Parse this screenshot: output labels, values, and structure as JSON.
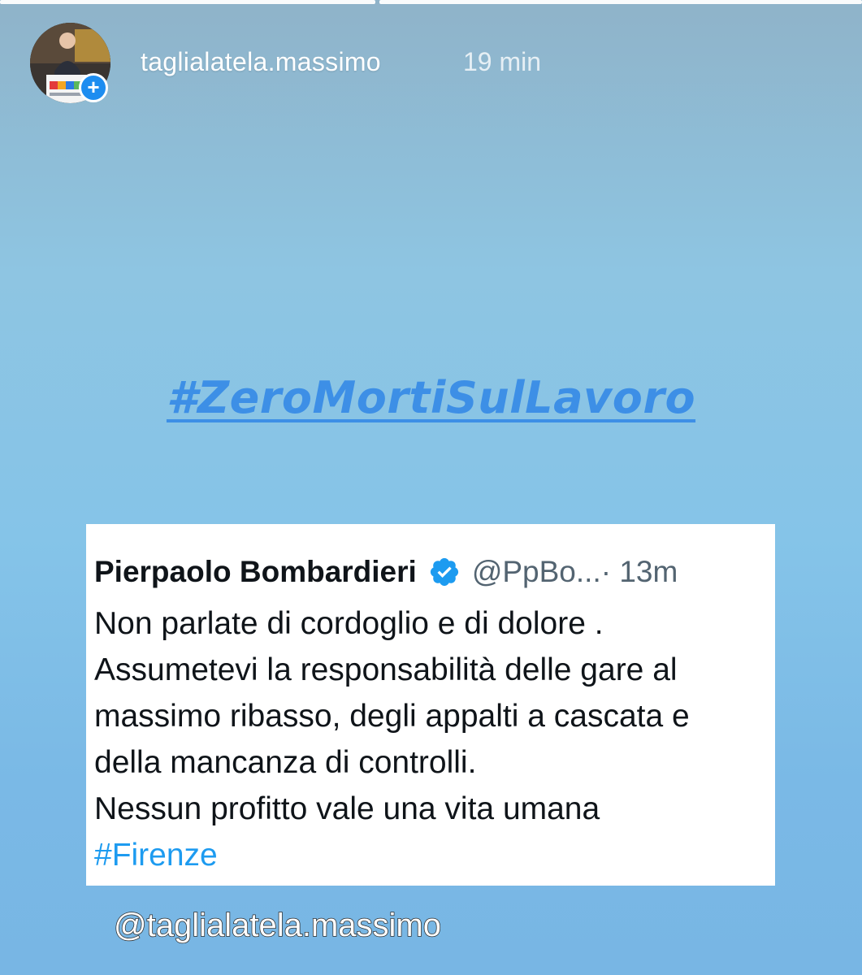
{
  "story": {
    "progress": [
      1,
      0
    ],
    "author": {
      "username": "taglialatela.massimo",
      "posted_ago": "19 min",
      "avatar_icon": "profile-photo",
      "add_icon": "plus-icon"
    }
  },
  "hashtag_banner": "#ZeroMortiSulLavoro",
  "tweet": {
    "author_name": "Pierpaolo Bombardieri",
    "verified_icon": "verified-badge-icon",
    "handle": "@PpBo...",
    "time": " · 13m",
    "lines": [
      "Non parlate di cordoglio e di dolore .",
      "Assumetevi la responsabilità delle gare al",
      "massimo ribasso, degli appalti a cascata e",
      "della mancanza di controlli.",
      "Nessun profitto vale una vita umana"
    ],
    "hashtag": "#Firenze"
  },
  "mention_sticker": "@taglialatela.massimo",
  "colors": {
    "hashtag_blue": "#3d8fe6",
    "twitter_blue": "#1d9bf0",
    "badge_blue": "#1d8df0"
  }
}
